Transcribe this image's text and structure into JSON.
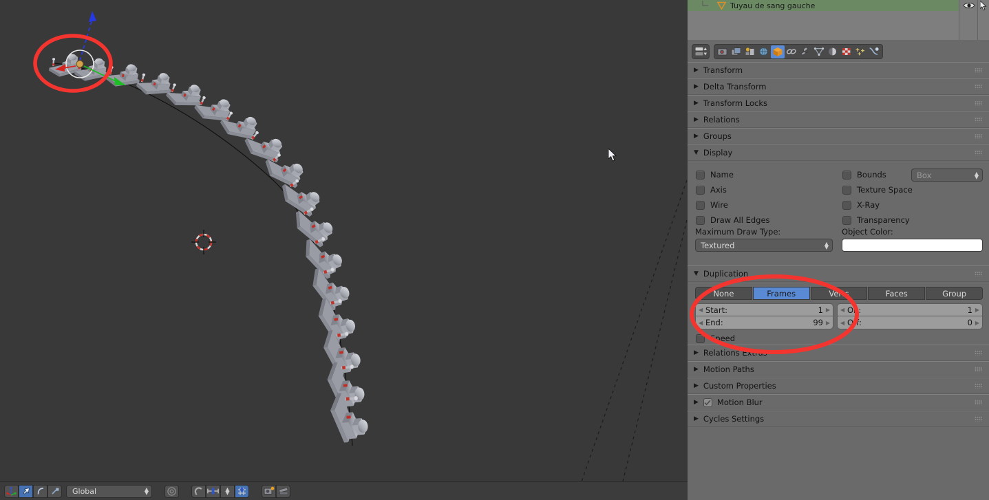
{
  "app": "Blender",
  "outliner": {
    "rows": [
      {
        "icon": "mesh-triangle-icon",
        "label": "Tuyau de sang gauche",
        "selected": true
      }
    ],
    "column_icons": [
      "eye-icon",
      "cursor-arrow-icon"
    ]
  },
  "properties_header": {
    "editor_type_icon": "properties-editor-icon",
    "tabs": [
      {
        "name": "render-tab",
        "icon": "camera-icon",
        "active": false
      },
      {
        "name": "render-layers-tab",
        "icon": "images-icon",
        "active": false
      },
      {
        "name": "scene-tab",
        "icon": "scene-icon",
        "active": false
      },
      {
        "name": "world-tab",
        "icon": "globe-icon",
        "active": false
      },
      {
        "name": "object-tab",
        "icon": "orange-cube-icon",
        "active": true
      },
      {
        "name": "constraints-tab",
        "icon": "chain-link-icon",
        "active": false
      },
      {
        "name": "modifiers-tab",
        "icon": "wrench-icon",
        "active": false
      },
      {
        "name": "object-data-tab",
        "icon": "mesh-data-icon",
        "active": false
      },
      {
        "name": "material-tab",
        "icon": "material-sphere-icon",
        "active": false
      },
      {
        "name": "texture-tab",
        "icon": "checker-texture-icon",
        "active": false
      },
      {
        "name": "particles-tab",
        "icon": "particles-icon",
        "active": false
      },
      {
        "name": "physics-tab",
        "icon": "physics-icon",
        "active": false
      }
    ]
  },
  "panels": [
    {
      "id": "transform",
      "label": "Transform",
      "open": false
    },
    {
      "id": "delta_transform",
      "label": "Delta Transform",
      "open": false
    },
    {
      "id": "transform_locks",
      "label": "Transform Locks",
      "open": false
    },
    {
      "id": "relations",
      "label": "Relations",
      "open": false
    },
    {
      "id": "groups",
      "label": "Groups",
      "open": false
    },
    {
      "id": "display",
      "label": "Display",
      "open": true
    },
    {
      "id": "duplication",
      "label": "Duplication",
      "open": true
    },
    {
      "id": "relations_extras",
      "label": "Relations Extras",
      "open": false
    },
    {
      "id": "motion_paths",
      "label": "Motion Paths",
      "open": false
    },
    {
      "id": "custom_properties",
      "label": "Custom Properties",
      "open": false
    },
    {
      "id": "motion_blur",
      "label": "Motion Blur",
      "open": false,
      "checkbox": true,
      "checked": true
    },
    {
      "id": "cycles_settings",
      "label": "Cycles Settings",
      "open": false
    }
  ],
  "display_panel": {
    "title": "Display",
    "left_checks": [
      {
        "label": "Name",
        "checked": false
      },
      {
        "label": "Axis",
        "checked": false
      },
      {
        "label": "Wire",
        "checked": false
      },
      {
        "label": "Draw All Edges",
        "checked": false
      }
    ],
    "right_checks": [
      {
        "label": "Bounds",
        "checked": false
      },
      {
        "label": "Texture Space",
        "checked": false
      },
      {
        "label": "X-Ray",
        "checked": false
      },
      {
        "label": "Transparency",
        "checked": false
      }
    ],
    "bounds_select": {
      "value": "Box",
      "enabled": false
    },
    "max_draw_type": {
      "label": "Maximum Draw Type:",
      "value": "Textured"
    },
    "object_color": {
      "label": "Object Color:",
      "value": "#ffffff"
    }
  },
  "duplication_panel": {
    "title": "Duplication",
    "modes": [
      {
        "label": "None",
        "active": false
      },
      {
        "label": "Frames",
        "active": true
      },
      {
        "label": "Verts",
        "active": false
      },
      {
        "label": "Faces",
        "active": false
      },
      {
        "label": "Group",
        "active": false
      }
    ],
    "fields_left": [
      {
        "label": "Start:",
        "value": "1"
      },
      {
        "label": "End:",
        "value": "99"
      }
    ],
    "fields_right": [
      {
        "label": "On:",
        "value": "1"
      },
      {
        "label": "Off:",
        "value": "0"
      }
    ],
    "speed": {
      "label": "Speed",
      "checked": false
    }
  },
  "viewport_footer": {
    "manipulator_buttons": [
      {
        "name": "manipulator-toggle",
        "icon": "axis-gizmo-icon",
        "active": false
      },
      {
        "name": "translate-manipulator",
        "icon": "arrow-icon",
        "active": true
      },
      {
        "name": "rotate-manipulator",
        "icon": "rotate-arc-icon",
        "active": false
      },
      {
        "name": "scale-manipulator",
        "icon": "scale-icon",
        "active": false
      }
    ],
    "orientation_select": {
      "value": "Global"
    },
    "right_buttons": [
      {
        "name": "proportional-edit",
        "icon": "circle-falloff-icon",
        "active": false
      },
      {
        "name": "snap-magnet",
        "icon": "magnet-icon",
        "active": false
      },
      {
        "name": "snap-element",
        "icon": "snap-vertex-icon",
        "active": false
      },
      {
        "name": "snap-target",
        "icon": "snap-target-icon",
        "active": true
      },
      {
        "name": "render-opengl-image",
        "icon": "render-image-icon",
        "active": false
      },
      {
        "name": "render-opengl-animation",
        "icon": "render-anim-icon",
        "active": false
      }
    ]
  },
  "viewport": {
    "background_color": "#393939",
    "objects_note": "arc of duplicated mesh objects following a bezier curve path",
    "gizmo": {
      "x_axis_color": "#e02a2a",
      "y_axis_color": "#22c02a",
      "z_axis_color": "#2233e0"
    },
    "cursor_3d": "3d-cursor-icon",
    "mouse_pointer": "mouse-cursor-icon"
  },
  "annotations": {
    "color": "#f4352f",
    "shapes": [
      {
        "name": "viewport-highlight-ellipse",
        "target": "selected source object with manipulator"
      },
      {
        "name": "duplication-highlight-ellipse",
        "target": "Duplication Frames settings"
      }
    ]
  }
}
